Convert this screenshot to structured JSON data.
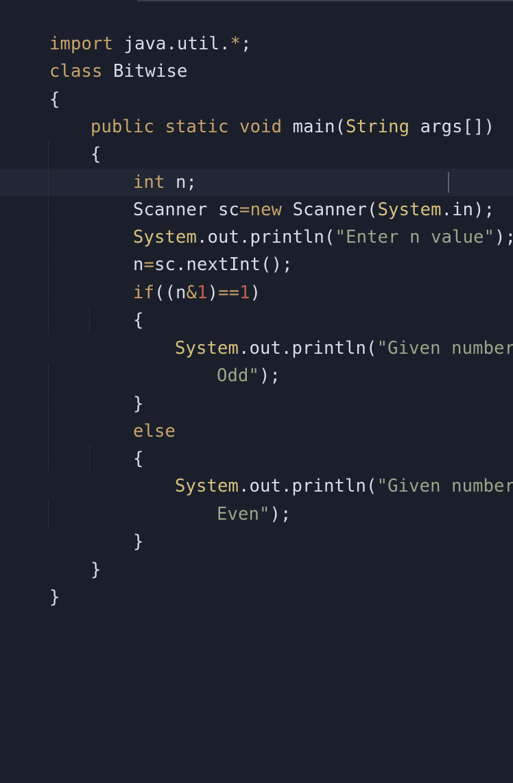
{
  "editor": {
    "language": "java",
    "theme_colors": {
      "background": "#1b1f2b",
      "current_line": "#222735",
      "keyword": "#c8a46a",
      "string": "#98a78a",
      "number": "#c0624f",
      "text": "#d8dee9"
    },
    "lines": [
      {
        "t1": "import",
        "t2": " java.util.",
        "t3": "*",
        "t4": ";"
      },
      {
        "t1": "class",
        "t2": " Bitwise"
      },
      {
        "t1": "{"
      },
      {
        "t1": "public",
        "t2": " ",
        "t3": "static",
        "t4": " ",
        "t5": "void",
        "t6": " main(",
        "t7": "String",
        "t8": " args[])"
      },
      {
        "t1": "{"
      },
      {
        "t1": "int",
        "t2": " n;"
      },
      {
        "t1": "Scanner sc",
        "t2": "=",
        "t3": "new",
        "t4": " Scanner(",
        "t5": "System",
        "t6": ".in);"
      },
      {
        "t1": "System",
        "t2": ".out.println(",
        "t3": "\"Enter n value\"",
        "t4": ");"
      },
      {
        "t1": "n",
        "t2": "=",
        "t3": "sc.nextInt();"
      },
      {
        "t1": "if",
        "t2": "((n",
        "t3": "&",
        "t4": "1",
        "t5": ")",
        "t6": "==",
        "t7": "1",
        "t8": ")"
      },
      {
        "t1": "{"
      },
      {
        "t1": "System",
        "t2": ".out.println(",
        "t3": "\"Given number is"
      },
      {
        "t1": "Odd\"",
        "t2": ");"
      },
      {
        "t1": "}"
      },
      {
        "t1": "else"
      },
      {
        "t1": "{"
      },
      {
        "t1": "System",
        "t2": ".out.println(",
        "t3": "\"Given number is"
      },
      {
        "t1": "Even\"",
        "t2": ");"
      },
      {
        "t1": "}"
      },
      {
        "t1": "}"
      },
      {
        "t1": "}"
      }
    ]
  }
}
